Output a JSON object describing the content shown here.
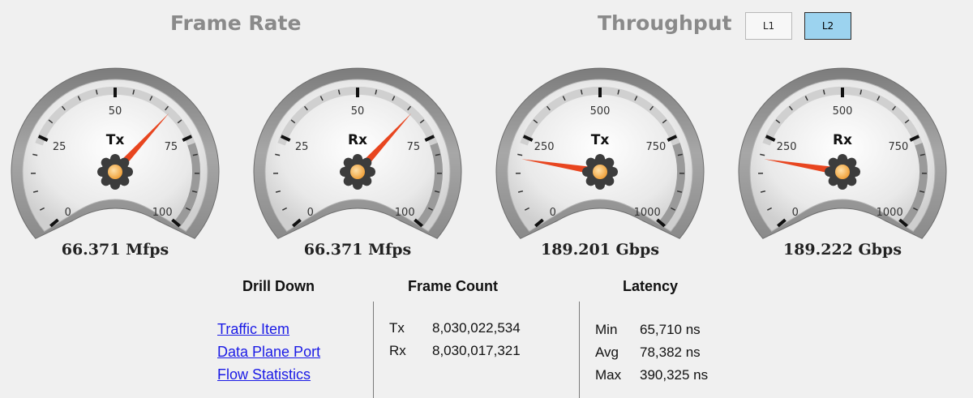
{
  "sections": {
    "frame_rate_title": "Frame Rate",
    "throughput_title": "Throughput"
  },
  "toggles": [
    {
      "label": "L1",
      "active": false
    },
    {
      "label": "L2",
      "active": true
    }
  ],
  "colors": {
    "needle": "#e8451f",
    "active_toggle": "#9cd3ef",
    "link": "#1a1ae6",
    "title_gray": "#8a8a8a"
  },
  "gauges": [
    {
      "center_label": "Tx",
      "ticks": [
        "0",
        "25",
        "50",
        "75",
        "100"
      ],
      "max": 100,
      "value": 66.371,
      "readout": "66.371 Mfps"
    },
    {
      "center_label": "Rx",
      "ticks": [
        "0",
        "25",
        "50",
        "75",
        "100"
      ],
      "max": 100,
      "value": 66.371,
      "readout": "66.371 Mfps"
    },
    {
      "center_label": "Tx",
      "ticks": [
        "0",
        "250",
        "500",
        "750",
        "1000"
      ],
      "max": 1000,
      "value": 189.201,
      "readout": "189.201 Gbps"
    },
    {
      "center_label": "Rx",
      "ticks": [
        "0",
        "250",
        "500",
        "750",
        "1000"
      ],
      "max": 1000,
      "value": 189.222,
      "readout": "189.222 Gbps"
    }
  ],
  "drill_down": {
    "header": "Drill Down",
    "links": [
      "Traffic Item",
      "Data Plane Port",
      "Flow Statistics"
    ]
  },
  "frame_count": {
    "header": "Frame Count",
    "rows": [
      {
        "label": "Tx",
        "value": "8,030,022,534"
      },
      {
        "label": "Rx",
        "value": "8,030,017,321"
      }
    ]
  },
  "latency": {
    "header": "Latency",
    "rows": [
      {
        "label": "Min",
        "value": "65,710 ns"
      },
      {
        "label": "Avg",
        "value": "78,382 ns"
      },
      {
        "label": "Max",
        "value": "390,325 ns"
      }
    ]
  }
}
